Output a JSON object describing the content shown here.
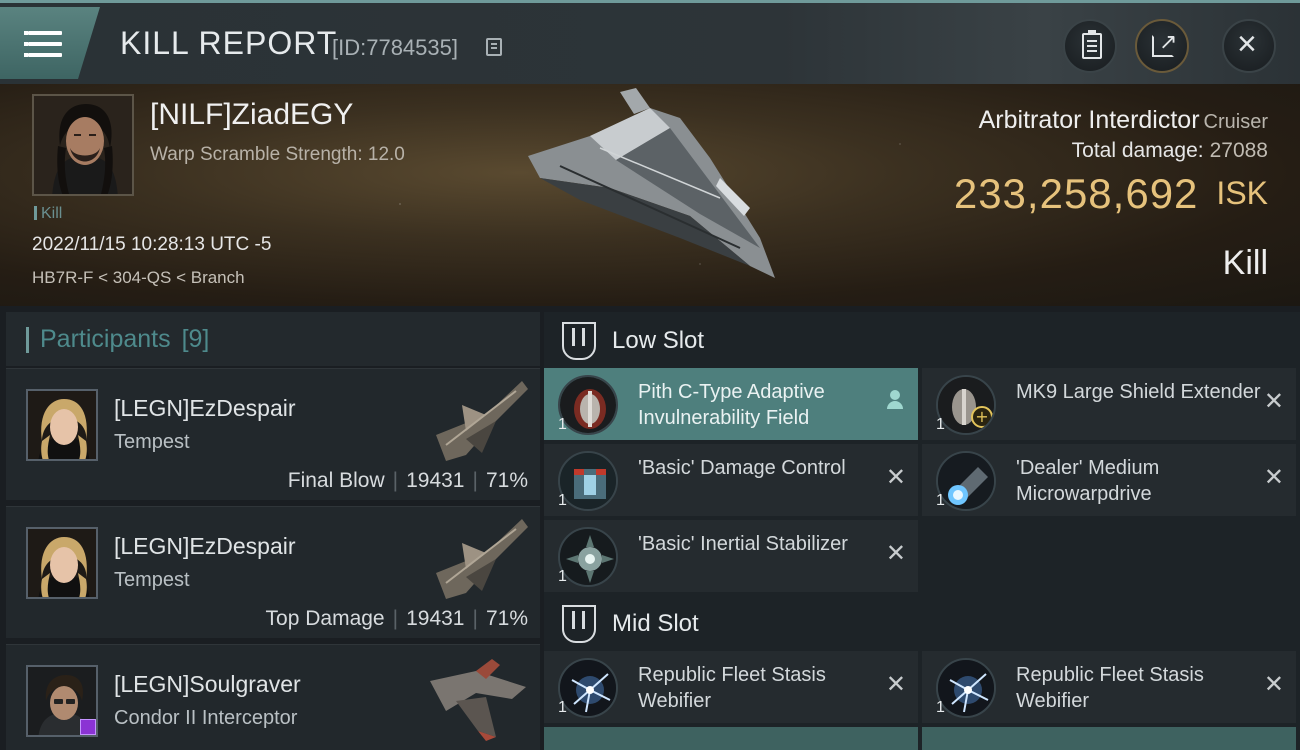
{
  "title_bar": {
    "title": "KILL REPORT",
    "report_id": "[ID:7784535]"
  },
  "victim": {
    "name": "[NILF]ZiadEGY",
    "warp_scramble": "Warp Scramble Strength: 12.0",
    "tag": "Kill",
    "timestamp": "2022/11/15 10:28:13 UTC -5",
    "location": "HB7R-F < 304-QS < Branch",
    "ship_name": "Arbitrator Interdictor",
    "ship_class": "Cruiser",
    "total_damage_label": "Total damage:",
    "total_damage_value": "27088",
    "isk_value": "233,258,692",
    "isk_unit": "ISK",
    "result": "Kill"
  },
  "participants": {
    "label": "Participants",
    "count": "[9]",
    "items": [
      {
        "name": "[LEGN]EzDespair",
        "ship": "Tempest",
        "role": "Final Blow",
        "damage": "19431",
        "percent": "71%"
      },
      {
        "name": "[LEGN]EzDespair",
        "ship": "Tempest",
        "role": "Top Damage",
        "damage": "19431",
        "percent": "71%"
      },
      {
        "name": "[LEGN]Soulgraver",
        "ship": "Condor II Interceptor"
      }
    ]
  },
  "fitting": {
    "low_slot": {
      "title": "Low Slot",
      "modules": [
        {
          "name": "Pith C-Type Adaptive Invulnerability Field",
          "qty": "1"
        },
        {
          "name": "MK9 Large Shield Extender",
          "qty": "1"
        },
        {
          "name": "'Basic' Damage Control",
          "qty": "1"
        },
        {
          "name": "'Dealer' Medium Microwarpdrive",
          "qty": "1"
        },
        {
          "name": "'Basic' Inertial Stabilizer",
          "qty": "1"
        }
      ]
    },
    "mid_slot": {
      "title": "Mid Slot",
      "modules": [
        {
          "name": "Republic Fleet Stasis Webifier",
          "qty": "1"
        },
        {
          "name": "Republic Fleet Stasis Webifier",
          "qty": "1"
        }
      ]
    }
  },
  "icons": {
    "close": "✕"
  }
}
